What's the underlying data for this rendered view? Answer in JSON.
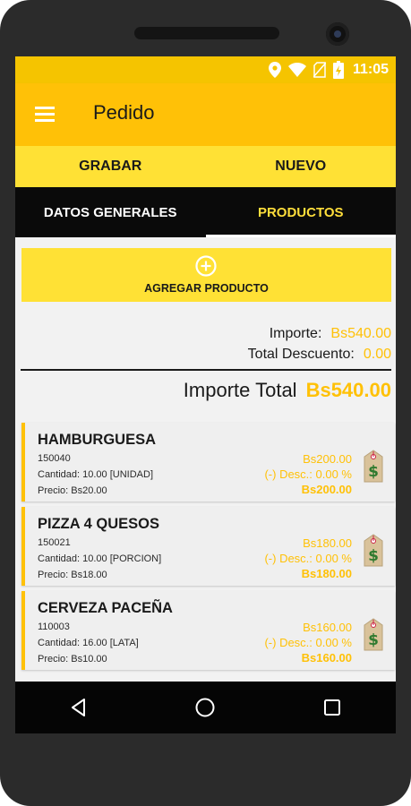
{
  "status": {
    "time": "11:05"
  },
  "appbar": {
    "title": "Pedido"
  },
  "actions": {
    "save": "GRABAR",
    "new": "NUEVO"
  },
  "tabs": [
    {
      "label": "DATOS GENERALES",
      "active": false
    },
    {
      "label": "PRODUCTOS",
      "active": true
    }
  ],
  "add_product": {
    "label": "AGREGAR PRODUCTO"
  },
  "summary": {
    "importe_label": "Importe:",
    "importe_value": "Bs540.00",
    "descuento_label": "Total Descuento:",
    "descuento_value": "0.00",
    "total_label": "Importe Total",
    "total_value": "Bs540.00"
  },
  "products": [
    {
      "name": "HAMBURGUESA",
      "code": "150040",
      "quantity": "Cantidad: 10.00 [UNIDAD]",
      "price": "Precio: Bs20.00",
      "amount": "Bs200.00",
      "discount": "(-) Desc.: 0.00 %",
      "total": "Bs200.00"
    },
    {
      "name": "PIZZA 4 QUESOS",
      "code": "150021",
      "quantity": "Cantidad: 10.00 [PORCION]",
      "price": "Precio: Bs18.00",
      "amount": "Bs180.00",
      "discount": "(-) Desc.: 0.00 %",
      "total": "Bs180.00"
    },
    {
      "name": "CERVEZA PACEÑA",
      "code": "110003",
      "quantity": "Cantidad: 16.00 [LATA]",
      "price": "Precio: Bs10.00",
      "amount": "Bs160.00",
      "discount": "(-) Desc.: 0.00 %",
      "total": "Bs160.00"
    }
  ],
  "icons": {
    "status": [
      "location-icon",
      "wifi-icon",
      "no-sim-icon",
      "battery-icon"
    ],
    "appbar": "menu-icon",
    "add": "add-circle-icon",
    "product": "price-tag-icon",
    "nav": [
      "back-icon",
      "home-icon",
      "recents-icon"
    ]
  },
  "colors": {
    "accent": "#ffc107",
    "light_accent": "#ffe135",
    "tab_active_text": "#ffde3b",
    "dark": "#0a0a0a"
  }
}
